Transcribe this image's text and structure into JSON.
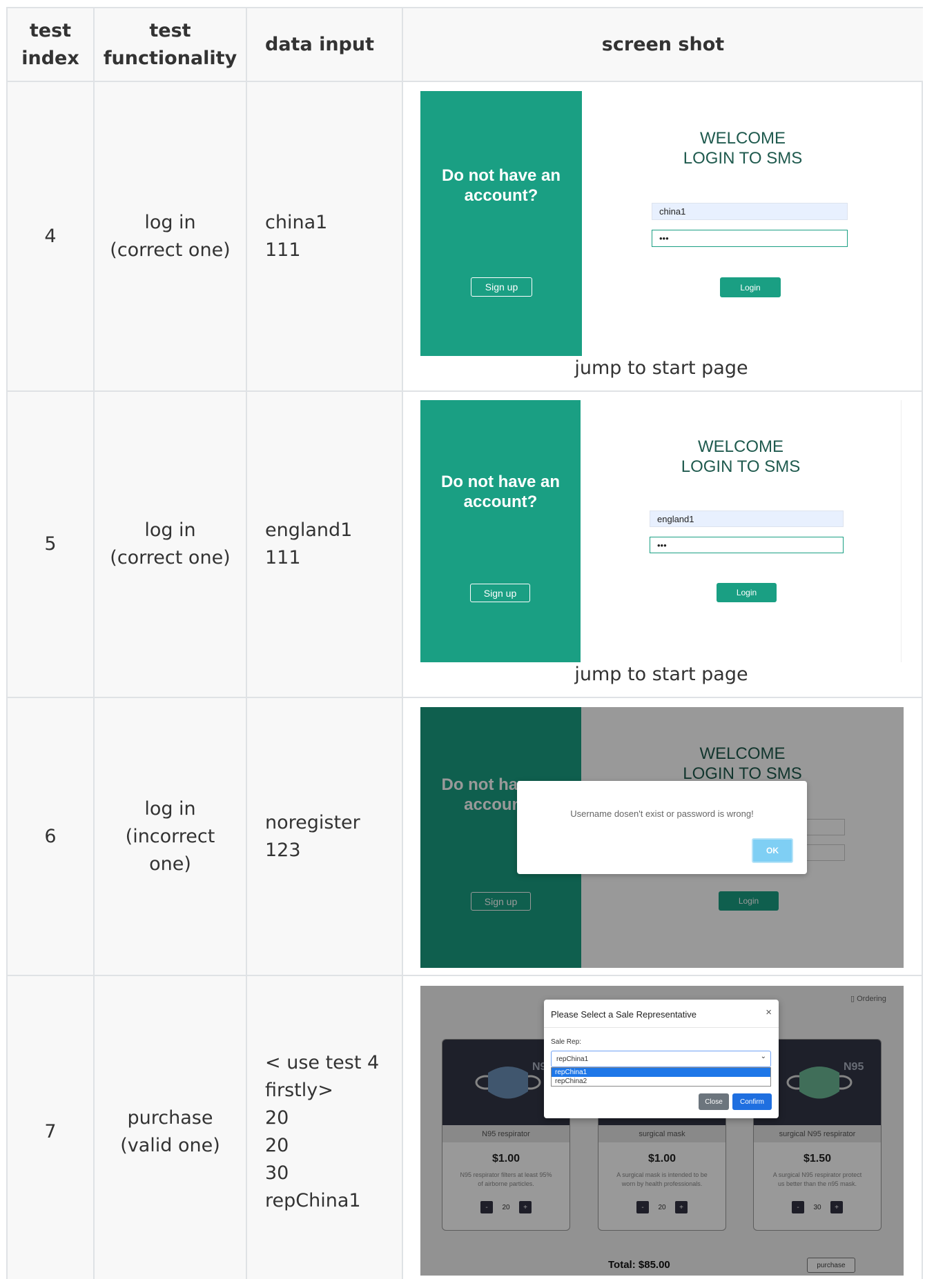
{
  "table": {
    "headers": {
      "index": [
        "test",
        "index"
      ],
      "functionality": [
        "test",
        "functionality"
      ],
      "data_input": "data input",
      "screen_shot": "screen shot"
    },
    "rows": [
      {
        "index": "4",
        "functionality": [
          "log in",
          "(correct one)"
        ],
        "data_input": [
          "china1",
          "111"
        ],
        "caption": "jump to start page",
        "shot": {
          "left_question": [
            "Do not have an",
            "account?"
          ],
          "signup": "Sign up",
          "welcome": [
            "WELCOME",
            "LOGIN TO SMS"
          ],
          "username": "china1",
          "password": "•••",
          "login": "Login"
        }
      },
      {
        "index": "5",
        "functionality": [
          "log in",
          "(correct one)"
        ],
        "data_input": [
          "england1",
          "111"
        ],
        "caption": "jump to start page",
        "shot": {
          "left_question": [
            "Do not have an",
            "account?"
          ],
          "signup": "Sign up",
          "welcome": [
            "WELCOME",
            "LOGIN TO SMS"
          ],
          "username": "england1",
          "password": "•••",
          "login": "Login"
        }
      },
      {
        "index": "6",
        "functionality": [
          "log in",
          "(incorrect",
          "one)"
        ],
        "data_input": [
          "noregister",
          "123"
        ],
        "shot": {
          "left_question": [
            "Do not have an",
            "account?"
          ],
          "signup": "Sign up",
          "welcome": [
            "WELCOME",
            "LOGIN TO SMS"
          ],
          "login": "Login",
          "alert_message": "Username dosen't exist or password is wrong!",
          "ok": "OK"
        }
      },
      {
        "index": "7",
        "functionality": [
          "purchase",
          "(valid one)"
        ],
        "data_input": [
          "< use test 4",
          "firstly>",
          "20",
          "20",
          "30",
          "repChina1"
        ],
        "shot": {
          "top_ordering": "Ordering",
          "modal_title": "Please Select a Sale Representative",
          "modal_close": "×",
          "sale_rep_label": "Sale Rep:",
          "selected_rep": "repChina1",
          "options": [
            "repChina1",
            "repChina2"
          ],
          "close_btn": "Close",
          "confirm_btn": "Confirm",
          "products": [
            {
              "name": "N95 respirator",
              "price": "$1.00",
              "desc": [
                "N95 respirator filters at least 95%",
                "of airborne particles."
              ],
              "qty": "20",
              "badge": "N95",
              "mask_color": "#6b8fb8"
            },
            {
              "name": "surgical mask",
              "price": "$1.00",
              "desc": [
                "A surgical mask is intended to be",
                "worn by health professionals."
              ],
              "qty": "20",
              "badge": "",
              "mask_color": "#8fb0d8"
            },
            {
              "name": "surgical N95 respirator",
              "price": "$1.50",
              "desc": [
                "A surgical N95 respirator protect",
                "us better than the n95 mask."
              ],
              "qty": "30",
              "badge": "N95",
              "mask_color": "#6bb894"
            }
          ],
          "minus": "-",
          "plus": "+",
          "total": "Total: $85.00",
          "purchase_btn": "purchase"
        }
      }
    ]
  },
  "colors": {
    "border": "#dfe2e5",
    "teal": "#1a9f83",
    "welcome_text": "#1f5a4e"
  }
}
